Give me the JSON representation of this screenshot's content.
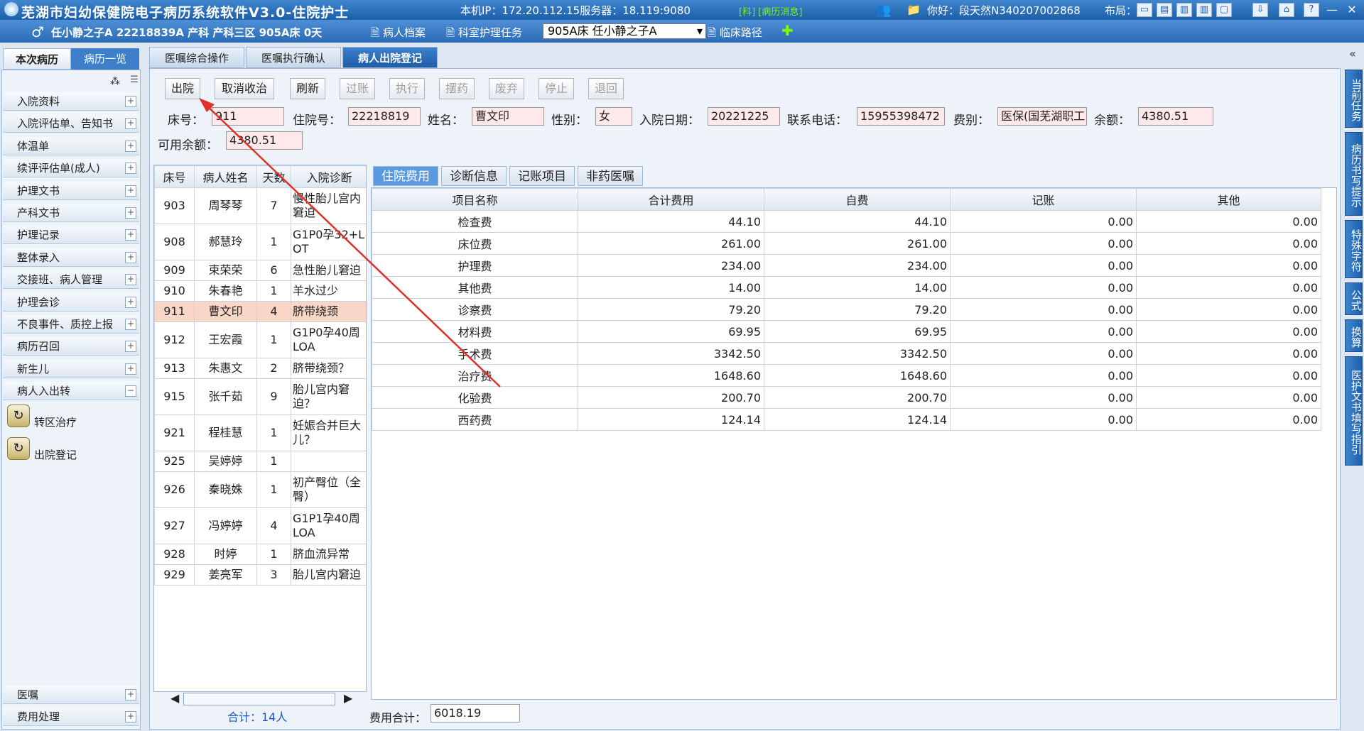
{
  "app": {
    "title": "芜湖市妇幼保健院电子病历系统软件V3.0-住院护士",
    "ip_info": "本机IP：172.20.112.15服务器：18.119:9080",
    "tips": "[科] [病历消息]",
    "greeting": "你好：段天然N340207002868",
    "layout_label": "布局："
  },
  "toolbar": {
    "patient": "任小静之子A 22218839A 产科 产科三区 905A床 0天",
    "patient_file": "病人档案",
    "dept_task": "科室护理任务",
    "bed_select": "905A床    任小静之子A",
    "clinical_path": "临床路径"
  },
  "left": {
    "tabs": [
      "本次病历",
      "病历一览"
    ],
    "menu": [
      "入院资料",
      "入院评估单、告知书",
      "体温单",
      "续评评估单(成人)",
      "护理文书",
      "产科文书",
      "护理记录",
      "整体录入",
      "交接班、病人管理",
      "护理会诊",
      "不良事件、质控上报",
      "病历召回",
      "新生儿",
      "病人入出转"
    ],
    "sub": [
      "转区治疗",
      "出院登记"
    ],
    "bottom": [
      "医嘱",
      "费用处理"
    ]
  },
  "main": {
    "tabs": [
      "医嘱综合操作",
      "医嘱执行确认",
      "病人出院登记"
    ],
    "buttons": [
      "出院",
      "取消收治",
      "刷新",
      "过账",
      "执行",
      "摆药",
      "废弃",
      "停止",
      "退回"
    ],
    "form": {
      "bed_label": "床号：",
      "bed": "911",
      "admit_label": "住院号：",
      "admit_no": "22218819",
      "name_label": "姓名：",
      "name": "曹文印",
      "sex_label": "性别：",
      "sex": "女",
      "date_label": "入院日期：",
      "date": "20221225",
      "phone_label": "联系电话：",
      "phone": "15955398472",
      "fee_type_label": "费别：",
      "fee_type": "医保(国芜湖职工",
      "balance_label": "余额：",
      "balance": "4380.51",
      "avail_label": "可用余额：",
      "avail": "4380.51"
    }
  },
  "patients": {
    "headers": [
      "床号",
      "病人姓名",
      "天数",
      "入院诊断"
    ],
    "rows": [
      [
        "903",
        "周琴琴",
        "7",
        "慢性胎儿宫内窘迫"
      ],
      [
        "908",
        "郝慧玲",
        "1",
        "G1P0孕32+LOT"
      ],
      [
        "909",
        "束荣荣",
        "6",
        "急性胎儿窘迫"
      ],
      [
        "910",
        "朱春艳",
        "1",
        "羊水过少"
      ],
      [
        "911",
        "曹文印",
        "4",
        "脐带绕颈"
      ],
      [
        "912",
        "王宏霞",
        "1",
        "G1P0孕40周LOA"
      ],
      [
        "913",
        "朱惠文",
        "2",
        "脐带绕颈？"
      ],
      [
        "915",
        "张千茹",
        "9",
        "胎儿宫内窘迫？"
      ],
      [
        "921",
        "程桂慧",
        "1",
        "妊娠合并巨大儿？"
      ],
      [
        "925",
        "吴婷婷",
        "1",
        ""
      ],
      [
        "926",
        "秦晓姝",
        "1",
        "初产臀位（全臀）"
      ],
      [
        "927",
        "冯婷婷",
        "4",
        "G1P1孕40周LOA"
      ],
      [
        "928",
        "时婷",
        "1",
        "脐血流异常"
      ],
      [
        "929",
        "姜亮军",
        "3",
        "胎儿宫内窘迫"
      ]
    ],
    "count": "合计：14人"
  },
  "fees": {
    "tabs": [
      "住院费用",
      "诊断信息",
      "记账项目",
      "非药医嘱"
    ],
    "headers": [
      "项目名称",
      "合计费用",
      "自费",
      "记账",
      "其他"
    ],
    "rows": [
      [
        "检查费",
        "44.10",
        "44.10",
        "0.00",
        "0.00"
      ],
      [
        "床位费",
        "261.00",
        "261.00",
        "0.00",
        "0.00"
      ],
      [
        "护理费",
        "234.00",
        "234.00",
        "0.00",
        "0.00"
      ],
      [
        "其他费",
        "14.00",
        "14.00",
        "0.00",
        "0.00"
      ],
      [
        "诊察费",
        "79.20",
        "79.20",
        "0.00",
        "0.00"
      ],
      [
        "材料费",
        "69.95",
        "69.95",
        "0.00",
        "0.00"
      ],
      [
        "手术费",
        "3342.50",
        "3342.50",
        "0.00",
        "0.00"
      ],
      [
        "治疗费",
        "1648.60",
        "1648.60",
        "0.00",
        "0.00"
      ],
      [
        "化验费",
        "200.70",
        "200.70",
        "0.00",
        "0.00"
      ],
      [
        "西药费",
        "124.14",
        "124.14",
        "0.00",
        "0.00"
      ]
    ],
    "total_label": "费用合计：",
    "total": "6018.19"
  },
  "right": {
    "tabs": [
      "当前任务",
      "病历书写提示",
      "特殊字符",
      "公式",
      "换算",
      "医护文书填写指引"
    ]
  },
  "colors": {
    "titlebar": "#1c5ea9",
    "selected_row": "#f8d6c8",
    "field_bg": "#fde9e9",
    "annotation": "#e0302a"
  }
}
